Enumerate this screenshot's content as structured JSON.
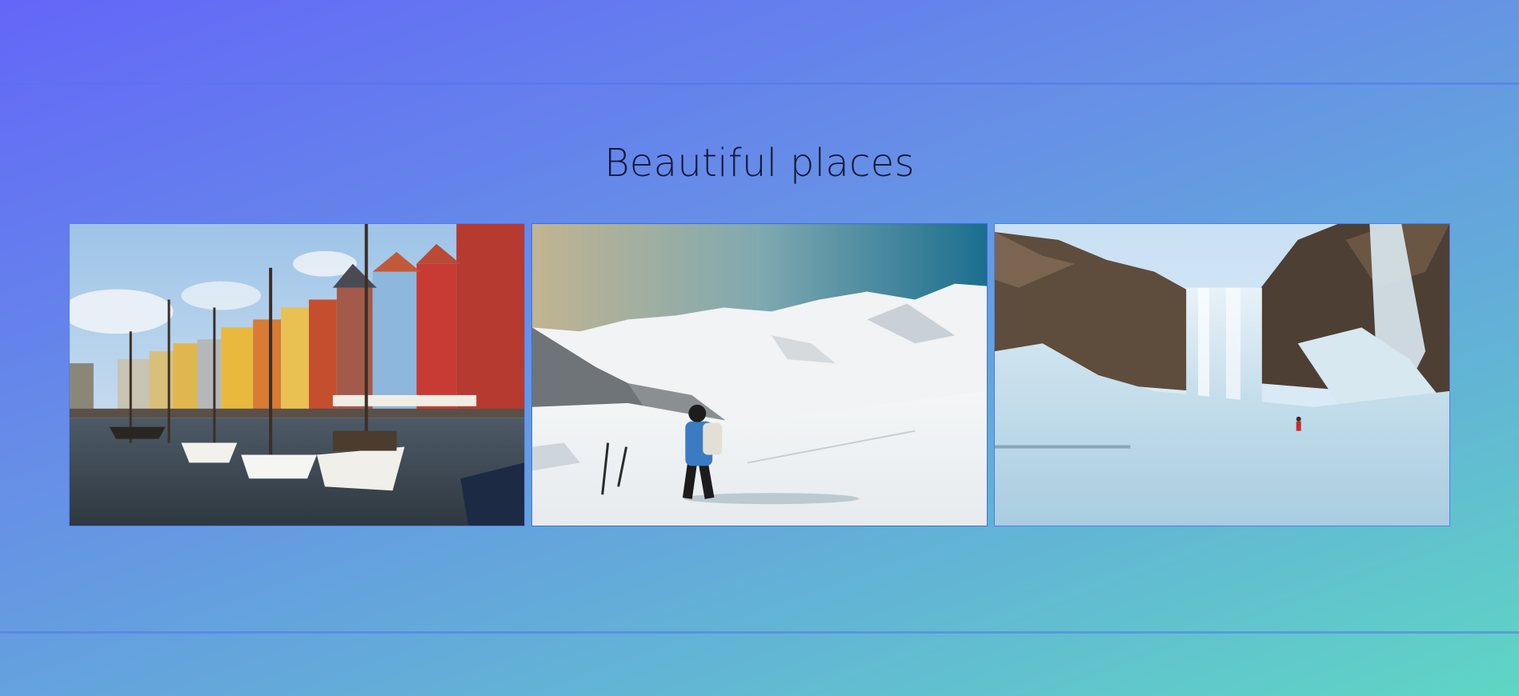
{
  "header": {
    "title": "Beautiful places"
  },
  "gallery": {
    "photos": [
      {
        "subject": "harbor with colorful buildings and sailboats"
      },
      {
        "subject": "hiker on snowy mountain"
      },
      {
        "subject": "frozen waterfall"
      }
    ]
  },
  "colors": {
    "accent": "#4f7df0",
    "title": "#121a36"
  }
}
